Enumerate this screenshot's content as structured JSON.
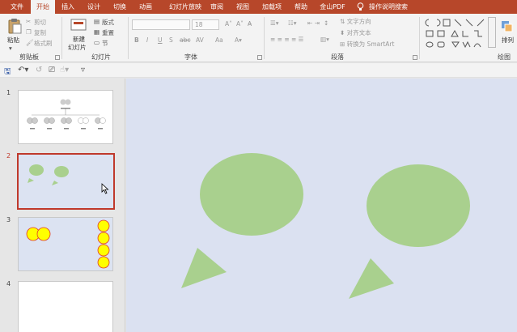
{
  "tabs": [
    "文件",
    "开始",
    "插入",
    "设计",
    "切换",
    "动画",
    "幻灯片放映",
    "审阅",
    "视图",
    "加载项",
    "帮助",
    "金山PDF"
  ],
  "active_tab": "开始",
  "tell_me": "操作说明搜索",
  "ribbon": {
    "clipboard": {
      "paste": "粘贴",
      "cut": "剪切",
      "copy": "复制",
      "format_painter": "格式刷",
      "label": "剪贴板"
    },
    "slides": {
      "new_slide_line1": "新建",
      "new_slide_line2": "幻灯片",
      "layout": "版式",
      "reset": "重置",
      "section": "节",
      "label": "幻灯片"
    },
    "font": {
      "font_size": "18",
      "bold": "B",
      "italic": "I",
      "underline": "U",
      "strike": "S",
      "shadow": "abc",
      "spacing": "AV",
      "case": "Aa",
      "label": "字体"
    },
    "paragraph": {
      "text_direction": "文字方向",
      "align_text": "对齐文本",
      "smartart": "转换为 SmartArt",
      "label": "段落"
    },
    "drawing": {
      "arrange": "排列",
      "label": "绘图"
    }
  },
  "slides": [
    {
      "number": "1",
      "selected": false
    },
    {
      "number": "2",
      "selected": true
    },
    {
      "number": "3",
      "selected": false
    },
    {
      "number": "4",
      "selected": false
    }
  ],
  "colors": {
    "accent": "#b7472a",
    "shape_green": "#a9d08e",
    "slide_bg": "#dbe1f1",
    "yellow": "#ffff00",
    "selection": "#c0392b"
  }
}
